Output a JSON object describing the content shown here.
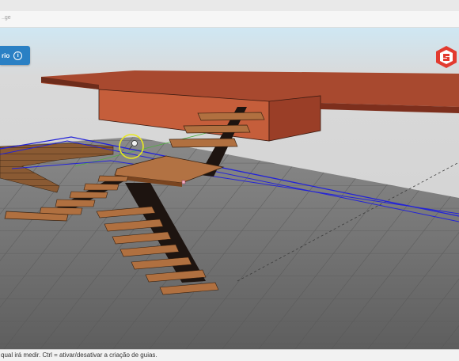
{
  "toolbar": {
    "hint": "..ge"
  },
  "instructor": {
    "label": "rio",
    "info_icon": "info-icon"
  },
  "logo": {
    "icon": "sketchup-logo"
  },
  "status": {
    "text": "qual irá medir. Ctrl = ativar/desativar a criação de guias."
  },
  "colors": {
    "accent": "#2a80c4",
    "slab": "#b14e33",
    "tread": "#a86a3b",
    "stringer": "#1d1410",
    "selection": "#2323d8",
    "floor": "#6f6f6f"
  }
}
